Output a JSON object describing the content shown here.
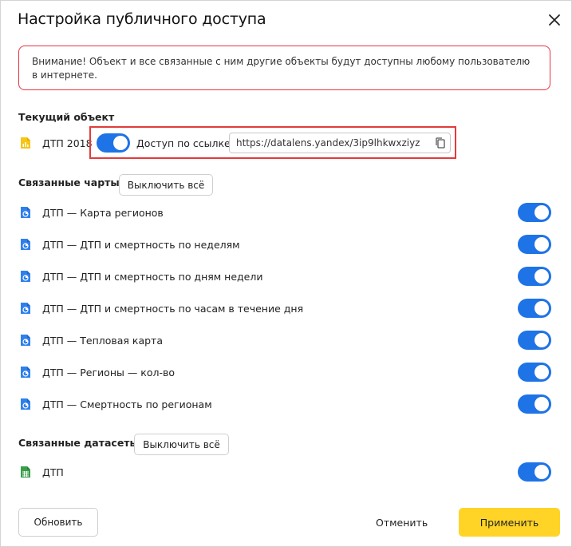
{
  "dialog": {
    "title": "Настройка публичного доступа",
    "warning": "Внимание! Объект и все связанные с ним другие объекты будут доступны любому пользователю в интернете."
  },
  "current": {
    "section_label": "Текущий объект",
    "name": "ДТП 2018",
    "access_label": "Доступ по ссылке",
    "url": "https://datalens.yandex/3ip9lhkwxziyz",
    "toggle_on": true
  },
  "charts": {
    "section_label": "Связанные чарты",
    "disable_all": "Выключить всё",
    "items": [
      {
        "label": "ДТП — Карта регионов",
        "on": true
      },
      {
        "label": "ДТП — ДТП и смертность по неделям",
        "on": true
      },
      {
        "label": "ДТП — ДТП и смертность по дням недели",
        "on": true
      },
      {
        "label": "ДТП — ДТП и смертность по часам в течение дня",
        "on": true
      },
      {
        "label": "ДТП — Тепловая карта",
        "on": true
      },
      {
        "label": "ДТП — Регионы — кол-во",
        "on": true
      },
      {
        "label": "ДТП — Смертность по регионам",
        "on": true
      }
    ]
  },
  "datasets": {
    "section_label": "Связанные датасеты",
    "disable_all": "Выключить всё",
    "items": [
      {
        "label": "ДТП",
        "on": true
      }
    ]
  },
  "footer": {
    "refresh": "Обновить",
    "cancel": "Отменить",
    "apply": "Применить"
  },
  "colors": {
    "accent": "#1e73e6",
    "primary_button": "#ffd426",
    "warning_border": "#e8343f",
    "highlight": "#e23b3b"
  },
  "icons": {
    "close": "close-icon",
    "dashboard": "dashboard-icon",
    "chart": "chart-icon",
    "dataset": "dataset-icon",
    "copy": "copy-icon"
  }
}
